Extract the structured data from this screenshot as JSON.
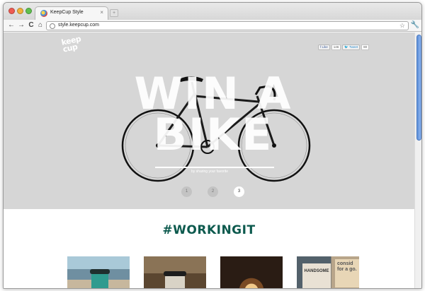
{
  "browser": {
    "tab_title": "KeepCup Style",
    "tab_close": "×",
    "new_tab": "+",
    "url": "style.keepcup.com",
    "back": "←",
    "forward": "→",
    "reload": "C",
    "home": "⌂",
    "bookmark_star": "☆",
    "wrench": "🔧"
  },
  "hero": {
    "logo_line1": "keep",
    "logo_line2": "cup",
    "share": {
      "like_label": "Like",
      "like_count": "146",
      "tweet_label": "Tweet",
      "tweet_count": "80"
    },
    "headline_line1": "WIN A",
    "headline_line2": "BIKE",
    "subline": "by sharing your favorite",
    "slides": [
      "1",
      "2",
      "3"
    ],
    "active_slide": 3
  },
  "section": {
    "title": "#WORKINGIT"
  },
  "thumbnails": {
    "handsome_label": "HANDSOME",
    "note_text": "consid for a go."
  },
  "colors": {
    "hero_background": "#d6d6d6",
    "section_title": "#0d5a4e",
    "scrollbar_thumb": "#5c8fd9"
  }
}
